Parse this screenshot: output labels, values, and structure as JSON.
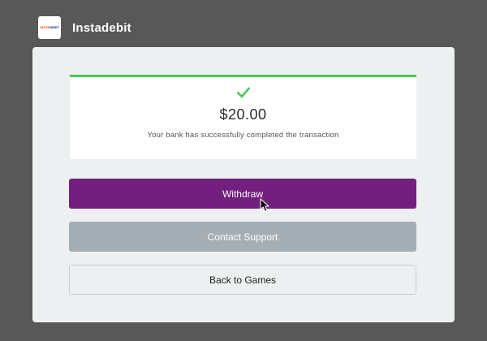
{
  "header": {
    "logo_text_prefix": "INSTA",
    "logo_text_suffix": "DEBIT",
    "title": "Instadebit"
  },
  "result": {
    "status_icon": "check-icon",
    "amount": "$20.00",
    "message": "Your bank has successfully completed the transaction"
  },
  "actions": {
    "withdraw_label": "Withdraw",
    "support_label": "Contact Support",
    "back_label": "Back to Games"
  },
  "colors": {
    "background": "#585858",
    "panel": "#edf0f1",
    "success": "#4cc45a",
    "primary": "#721f7e",
    "secondary": "#a5aeb4"
  }
}
